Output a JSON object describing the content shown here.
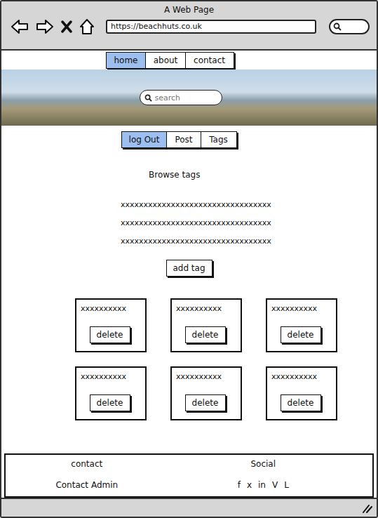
{
  "window": {
    "title": "A Web Page"
  },
  "address_bar": {
    "url": "https://beachhuts.co.uk"
  },
  "nav": {
    "tabs": [
      {
        "label": "home",
        "selected": true
      },
      {
        "label": "about",
        "selected": false
      },
      {
        "label": "contact",
        "selected": false
      }
    ]
  },
  "banner": {
    "search": {
      "placeholder": "search"
    }
  },
  "actions": [
    {
      "label": "log Out",
      "selected": true
    },
    {
      "label": "Post",
      "selected": false
    },
    {
      "label": "Tags",
      "selected": false
    }
  ],
  "browse": {
    "title": "Browse tags",
    "lines": [
      "xxxxxxxxxxxxxxxxxxxxxxxxxxxxxxxxx",
      "xxxxxxxxxxxxxxxxxxxxxxxxxxxxxxxxx",
      "xxxxxxxxxxxxxxxxxxxxxxxxxxxxxxxxx"
    ],
    "button": "add tag"
  },
  "cards": [
    {
      "text": "xxxxxxxxxx",
      "button": "delete"
    },
    {
      "text": "xxxxxxxxxx",
      "button": "delete"
    },
    {
      "text": "xxxxxxxxxx",
      "button": "delete"
    },
    {
      "text": "xxxxxxxxxx",
      "button": "delete"
    },
    {
      "text": "xxxxxxxxxx",
      "button": "delete"
    },
    {
      "text": "xxxxxxxxxx",
      "button": "delete"
    }
  ],
  "footer": {
    "columns": [
      {
        "heading": "contact",
        "items": [
          "Contact Admin"
        ]
      },
      {
        "heading": "Social",
        "items": [
          "f",
          "x",
          "in",
          "V",
          "L"
        ]
      }
    ]
  }
}
